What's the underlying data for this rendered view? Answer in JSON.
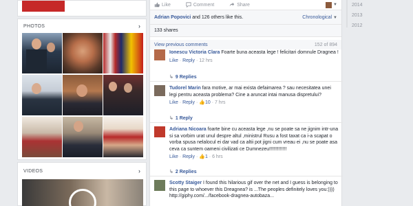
{
  "sidebar": {
    "photos_title": "PHOTOS",
    "videos_title": "VIDEOS"
  },
  "post": {
    "actions": {
      "like": "Like",
      "comment": "Comment",
      "share": "Share"
    },
    "likes_name": "Adrian Popovici",
    "likes_rest": "and 126 others like this.",
    "order": "Chronological",
    "shares": "133 shares",
    "view_previous": "View previous comments",
    "count": "152 of 894"
  },
  "comments": [
    {
      "name": "Ionescu Victoria Clara",
      "text": "Foarte buna aceasta lege ! felicitari domnule Dragnea !",
      "like": "Like",
      "reply": "Reply",
      "time": "12 hrs",
      "reactions": "",
      "replies": "9 Replies",
      "avatar_color": "#b56a4a"
    },
    {
      "name": "Tudorel Marin",
      "text": "fara motive, ar mai exista defaimarea ? sau necesitatea unei legi pentru aceasta problema? Cine a aruncat intai manusa dispretului?",
      "like": "Like",
      "reply": "Reply",
      "time": "7 hrs",
      "reactions": "10",
      "replies": "1 Reply",
      "avatar_color": "#7a6a5c"
    },
    {
      "name": "Adriana Nicoara",
      "text": "foarte bine cu aceasta lege ,nu se poate sa ne jignim intr-una si sa vorbim urat unul despre altul ,ministrul Rusu a fost taxat ca i-a scapat o vorba spusa nelalocul ei dar vad ca altii pot jigni cum vreau ei ,nu se poate asa ceva ca suntem oameni civilizati ce Dumnezeu!!!!!!!!!!!!!",
      "like": "Like",
      "reply": "Reply",
      "time": "6 hrs",
      "reactions": "1",
      "replies": "2 Replies",
      "avatar_color": "#c0392b"
    },
    {
      "name": "Scotty Staiger",
      "text": "I found this hilarious gif over the net and I guess is belonging to this page to whoever this Dreagnea? is ...The peoples definitely loves you:)))) http://giphy.com/.../facebook-dragnea-autobaza...",
      "avatar_color": "#6d7b5a"
    }
  ],
  "years": [
    "2014",
    "2013",
    "2012"
  ]
}
